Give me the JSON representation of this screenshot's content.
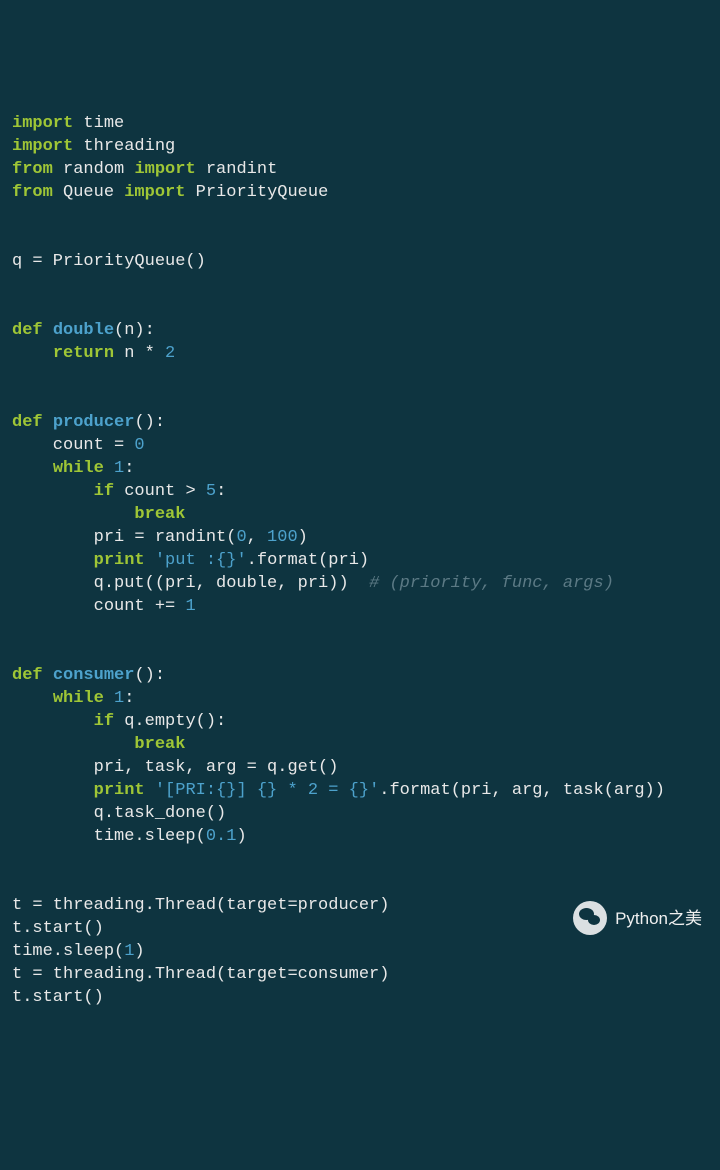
{
  "code": {
    "l1": {
      "kw1": "import",
      "t1": " time"
    },
    "l2": {
      "kw1": "import",
      "t1": " threading"
    },
    "l3": {
      "kw1": "from",
      "t1": " random ",
      "kw2": "import",
      "t2": " randint"
    },
    "l4": {
      "kw1": "from",
      "t1": " Queue ",
      "kw2": "import",
      "t2": " PriorityQueue"
    },
    "l5": {
      "t1": "q = PriorityQueue()"
    },
    "l6": {
      "kw1": "def",
      "t1": " ",
      "def1": "double",
      "t2": "(n):"
    },
    "l7": {
      "t1": "    ",
      "kw1": "return",
      "t2": " n * ",
      "n1": "2"
    },
    "l8": {
      "kw1": "def",
      "t1": " ",
      "def1": "producer",
      "t2": "():"
    },
    "l9": {
      "t1": "    count = ",
      "n1": "0"
    },
    "l10": {
      "t1": "    ",
      "kw1": "while",
      "t2": " ",
      "n1": "1",
      "t3": ":"
    },
    "l11": {
      "t1": "        ",
      "kw1": "if",
      "t2": " count > ",
      "n1": "5",
      "t3": ":"
    },
    "l12": {
      "t1": "            ",
      "kw1": "break"
    },
    "l13": {
      "t1": "        pri = randint(",
      "n1": "0",
      "t2": ", ",
      "n2": "100",
      "t3": ")"
    },
    "l14": {
      "t1": "        ",
      "kw1": "print",
      "t2": " ",
      "s1": "'put :{}'",
      "t3": ".format(pri)"
    },
    "l15": {
      "t1": "        q.put((pri, double, pri))  ",
      "c1": "# (priority, func, args)"
    },
    "l16": {
      "t1": "        count += ",
      "n1": "1"
    },
    "l17": {
      "kw1": "def",
      "t1": " ",
      "def1": "consumer",
      "t2": "():"
    },
    "l18": {
      "t1": "    ",
      "kw1": "while",
      "t2": " ",
      "n1": "1",
      "t3": ":"
    },
    "l19": {
      "t1": "        ",
      "kw1": "if",
      "t2": " q.empty():"
    },
    "l20": {
      "t1": "            ",
      "kw1": "break"
    },
    "l21": {
      "t1": "        pri, task, arg = q.get()"
    },
    "l22": {
      "t1": "        ",
      "kw1": "print",
      "t2": " ",
      "s1": "'[PRI:{}] {} * 2 = {}'",
      "t3": ".format(pri, arg, task(arg))"
    },
    "l23": {
      "t1": "        q.task_done()"
    },
    "l24": {
      "t1": "        time.sleep(",
      "n1": "0.1",
      "t2": ")"
    },
    "l25": {
      "t1": "t = threading.Thread(target=producer)"
    },
    "l26": {
      "t1": "t.start()"
    },
    "l27": {
      "t1": "time.sleep(",
      "n1": "1",
      "t2": ")"
    },
    "l28": {
      "t1": "t = threading.Thread(target=consumer)"
    },
    "l29": {
      "t1": "t.start()"
    }
  },
  "branding": {
    "text": "Python之美"
  }
}
